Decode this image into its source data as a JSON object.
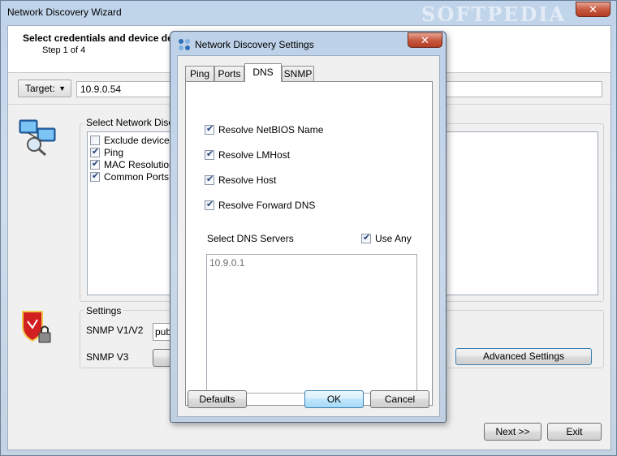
{
  "wizard": {
    "title": "Network Discovery Wizard",
    "watermark": "SOFTPEDIA",
    "close_glyph": "✕",
    "header_title": "Select credentials and device de",
    "header_step": "Step 1 of 4",
    "target_label": "Target:",
    "target_value": "10.9.0.54",
    "discovery_group": "Select Network Discov",
    "discovery_items": [
      {
        "label": "Exclude devices i",
        "checked": false
      },
      {
        "label": "Ping",
        "checked": true
      },
      {
        "label": "MAC Resolution",
        "checked": true
      },
      {
        "label": "Common Ports",
        "checked": true
      }
    ],
    "settings_group": "Settings",
    "snmp_v1_label": "SNMP V1/V2",
    "snmp_v1_value": "publ",
    "snmp_v3_label": "SNMP V3",
    "advanced_button": "Advanced Settings",
    "next_button": "Next >>",
    "exit_button": "Exit"
  },
  "dialog": {
    "title": "Network Discovery Settings",
    "close_glyph": "✕",
    "tabs": [
      "Ping",
      "Ports",
      "DNS",
      "SNMP"
    ],
    "active_tab": "DNS",
    "options": [
      {
        "label": "Resolve NetBIOS Name",
        "checked": true
      },
      {
        "label": "Resolve LMHost",
        "checked": true
      },
      {
        "label": "Resolve Host",
        "checked": true
      },
      {
        "label": "Resolve Forward DNS",
        "checked": true
      }
    ],
    "dns_servers_label": "Select DNS Servers",
    "use_any_label": "Use Any",
    "use_any_checked": true,
    "dns_servers": [
      "10.9.0.1"
    ],
    "defaults_button": "Defaults",
    "ok_button": "OK",
    "cancel_button": "Cancel"
  }
}
